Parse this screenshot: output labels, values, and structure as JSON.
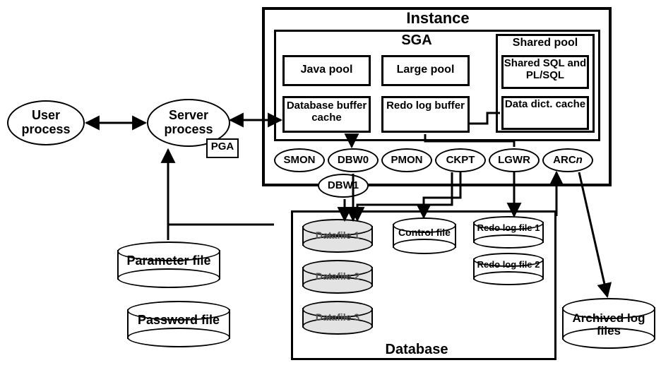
{
  "instance": {
    "title": "Instance",
    "sga": {
      "title": "SGA",
      "java_pool": "Java pool",
      "large_pool": "Large pool",
      "db_buffer_cache": "Database buffer cache",
      "redo_log_buffer": "Redo log buffer",
      "shared_pool": {
        "title": "Shared pool",
        "shared_sql": "Shared SQL and PL/SQL",
        "data_dict_cache": "Data dict. cache"
      }
    },
    "processes": {
      "smon": "SMON",
      "dbw0": "DBW0",
      "dbw1": "DBW1",
      "pmon": "PMON",
      "ckpt": "CKPT",
      "lgwr": "LGWR",
      "arcn": "ARCn"
    }
  },
  "user_process": "User process",
  "server_process": "Server process",
  "pga": "PGA",
  "database": {
    "title": "Database",
    "datafile1": "Datafile 1",
    "datafile2": "Datafile 2",
    "datafile3": "Datafile 3",
    "control_file": "Control file",
    "redo_log_file1": "Redo log file 1",
    "redo_log_file2": "Redo log file 2"
  },
  "parameter_file": "Parameter file",
  "password_file": "Password file",
  "archived_log_files": "Archived log files"
}
